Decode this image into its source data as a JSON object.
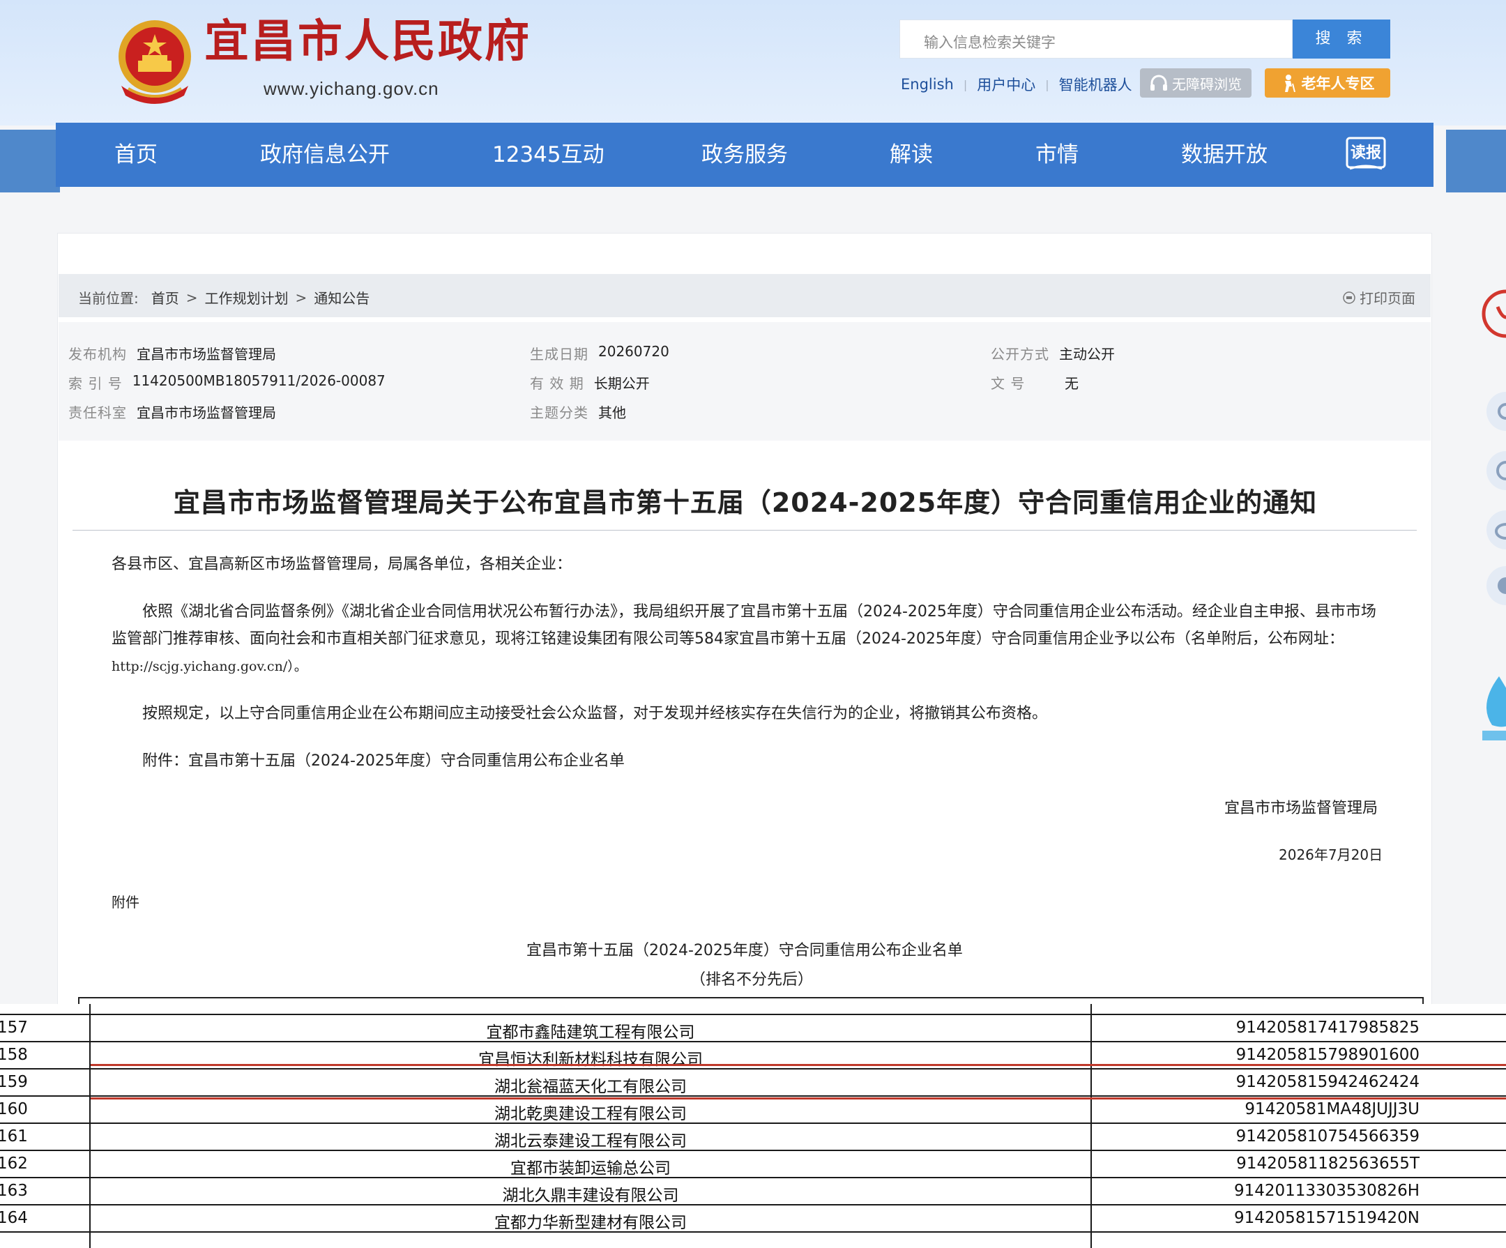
{
  "header": {
    "site_name": "宜昌市人民政府",
    "site_url": "www.yichang.gov.cn",
    "search_placeholder": "输入信息检索关键字",
    "search_button": "搜 索",
    "links": [
      "English",
      "用户中心",
      "智能机器人"
    ],
    "accessible_button": "无障碍浏览",
    "elder_button": "老年人专区",
    "colors": {
      "brand_red": "#b81e1e",
      "nav_blue": "#3a79ce",
      "accent_orange": "#f0a231"
    }
  },
  "nav": {
    "items": [
      "首页",
      "政府信息公开",
      "12345互动",
      "政务服务",
      "解读",
      "市情",
      "数据开放"
    ],
    "read_icon_label": "读报"
  },
  "breadcrumb": {
    "prefix": "当前位置:",
    "items": [
      "首页",
      "工作规划计划",
      "通知公告"
    ],
    "separator": ">",
    "print_label": "打印页面"
  },
  "meta": {
    "publisher_label": "发布机构",
    "publisher": "宜昌市市场监督管理局",
    "index_label": "索 引 号",
    "index": "11420500MB18057911/2026-00087",
    "dept_label": "责任科室",
    "dept": "宜昌市市场监督管理局",
    "date_label": "生成日期",
    "date": "20260720",
    "validity_label": "有 效 期",
    "validity": "长期公开",
    "topic_label": "主题分类",
    "topic": "其他",
    "open_label": "公开方式",
    "open": "主动公开",
    "docno_label": "文 号",
    "docno": "无"
  },
  "article": {
    "title": "宜昌市市场监督管理局关于公布宜昌市第十五届（2024-2025年度）守合同重信用企业的通知",
    "salutation": "各县市区、宜昌高新区市场监督管理局，局属各单位，各相关企业：",
    "p1_line1": "依照《湖北省合同监督条例》《湖北省企业合同信用状况公布暂行办法》，我局组织开展了宜昌市第十五届（2024-2025年度）守合同重信用企业公布活动。经企业自主申报、县市市场",
    "p1_line2": "监管部门推荐审核、面向社会和市直相关部门征求意见，现将江铭建设集团有限公司等584家宜昌市第十五届（2024-2025年度）守合同重信用企业予以公布（名单附后，公布网址：",
    "p1_line3": "http://scjg.yichang.gov.cn/）。",
    "p2": "按照规定，以上守合同重信用企业在公布期间应主动接受社会公众监督，对于发现并经核实存在失信行为的企业，将撤销其公布资格。",
    "p3": "附件：宜昌市第十五届（2024-2025年度）守合同重信用公布企业名单",
    "signature": "宜昌市市场监督管理局",
    "sign_date": "2026年7月20日",
    "attachment_label": "附件",
    "list_title": "宜昌市第十五届（2024-2025年度）守合同重信用公布企业名单",
    "list_subtitle": "（排名不分先后）"
  },
  "table": {
    "rows": [
      {
        "num": "157",
        "name": "宜都市鑫陆建筑工程有限公司",
        "code": "91420581741798582 5"
      },
      {
        "num": "158",
        "name": "宜昌恒达利新材料科技有限公司",
        "code": "914205815798901600"
      },
      {
        "num": "159",
        "name": "湖北瓮福蓝天化工有限公司",
        "code": "914205815942462424"
      },
      {
        "num": "160",
        "name": "湖北乾奥建设工程有限公司",
        "code": "91420581MA48JUJJ3U"
      },
      {
        "num": "161",
        "name": "湖北云泰建设工程有限公司",
        "code": "914205810754566359"
      },
      {
        "num": "162",
        "name": "宜都市装卸运输总公司",
        "code": "91420581182563655T"
      },
      {
        "num": "163",
        "name": "湖北久鼎丰建设有限公司",
        "code": "91420113303530826H"
      },
      {
        "num": "164",
        "name": "宜都力华新型建材有限公司",
        "code": "91420581571519420N"
      }
    ]
  }
}
